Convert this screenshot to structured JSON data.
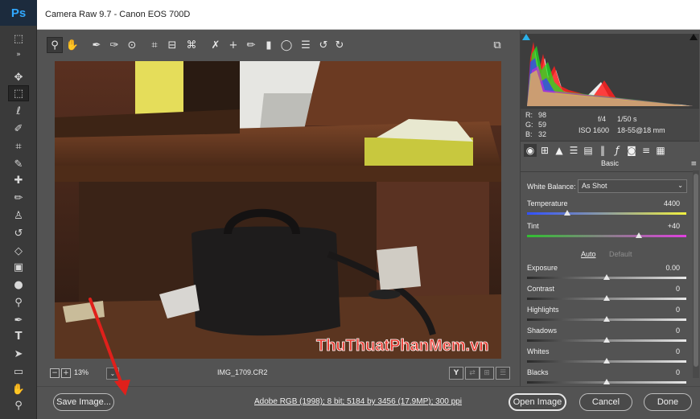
{
  "ps": {
    "logo": "Ps",
    "tools": [
      "marquee-tool-icon",
      "expand-icon",
      "move-tool-icon",
      "rect-marquee-tool-icon",
      "lasso-tool-icon",
      "quick-select-tool-icon",
      "crop-tool-icon",
      "eyedropper-tool-icon",
      "healing-brush-tool-icon",
      "brush-tool-icon",
      "clone-stamp-tool-icon",
      "history-brush-tool-icon",
      "eraser-tool-icon",
      "gradient-tool-icon",
      "blur-tool-icon",
      "dodge-tool-icon",
      "pen-tool-icon",
      "type-tool-icon",
      "path-select-tool-icon",
      "rectangle-tool-icon",
      "hand-tool-icon",
      "zoom-tool-icon"
    ],
    "selected_tool": "rect-marquee-tool-icon"
  },
  "dialog": {
    "title": "Camera Raw 9.7  -  Canon EOS 700D"
  },
  "toolbar": {
    "icons": [
      "zoom-tool-icon",
      "hand-tool-icon",
      "white-balance-tool-icon",
      "color-sampler-tool-icon",
      "targeted-adjustment-tool-icon",
      "crop-tool-icon",
      "straighten-tool-icon",
      "transform-tool-icon",
      "spot-removal-tool-icon",
      "red-eye-tool-icon",
      "adjustment-brush-icon",
      "graduated-filter-icon",
      "radial-filter-icon",
      "preferences-icon",
      "rotate-ccw-icon",
      "rotate-cw-icon"
    ],
    "fullscreen_icon": "fullscreen-toggle-icon"
  },
  "status": {
    "zoom": "13%",
    "filename": "IMG_1709.CR2",
    "view_buttons": [
      "Y"
    ]
  },
  "bottom": {
    "save_label": "Save Image...",
    "workflow": "Adobe RGB (1998); 8 bit; 5184 by 3456 (17.9MP); 300 ppi",
    "open_label": "Open Image",
    "cancel_label": "Cancel",
    "done_label": "Done"
  },
  "readout": {
    "r_label": "R:",
    "r": "98",
    "g_label": "G:",
    "g": "59",
    "b_label": "B:",
    "b": "32",
    "aperture": "f/4",
    "shutter": "1/50 s",
    "iso": "ISO 1600",
    "lens": "18-55@18 mm"
  },
  "panel": {
    "title": "Basic",
    "wb_label": "White Balance:",
    "wb_value": "As Shot",
    "auto": "Auto",
    "default": "Default",
    "sliders": [
      {
        "label": "Temperature",
        "value": "4400",
        "fraction": 0.25
      },
      {
        "label": "Tint",
        "value": "+40",
        "fraction": 0.7
      },
      {
        "label": "Exposure",
        "value": "0.00",
        "fraction": 0.5
      },
      {
        "label": "Contrast",
        "value": "0",
        "fraction": 0.5
      },
      {
        "label": "Highlights",
        "value": "0",
        "fraction": 0.5
      },
      {
        "label": "Shadows",
        "value": "0",
        "fraction": 0.5
      },
      {
        "label": "Whites",
        "value": "0",
        "fraction": 0.5
      },
      {
        "label": "Blacks",
        "value": "0",
        "fraction": 0.5
      }
    ]
  },
  "watermark": "ThuThuatPhanMem.vn",
  "colors": {
    "accent_arrow": "#e0201b",
    "ps_blue": "#31a8ff"
  }
}
